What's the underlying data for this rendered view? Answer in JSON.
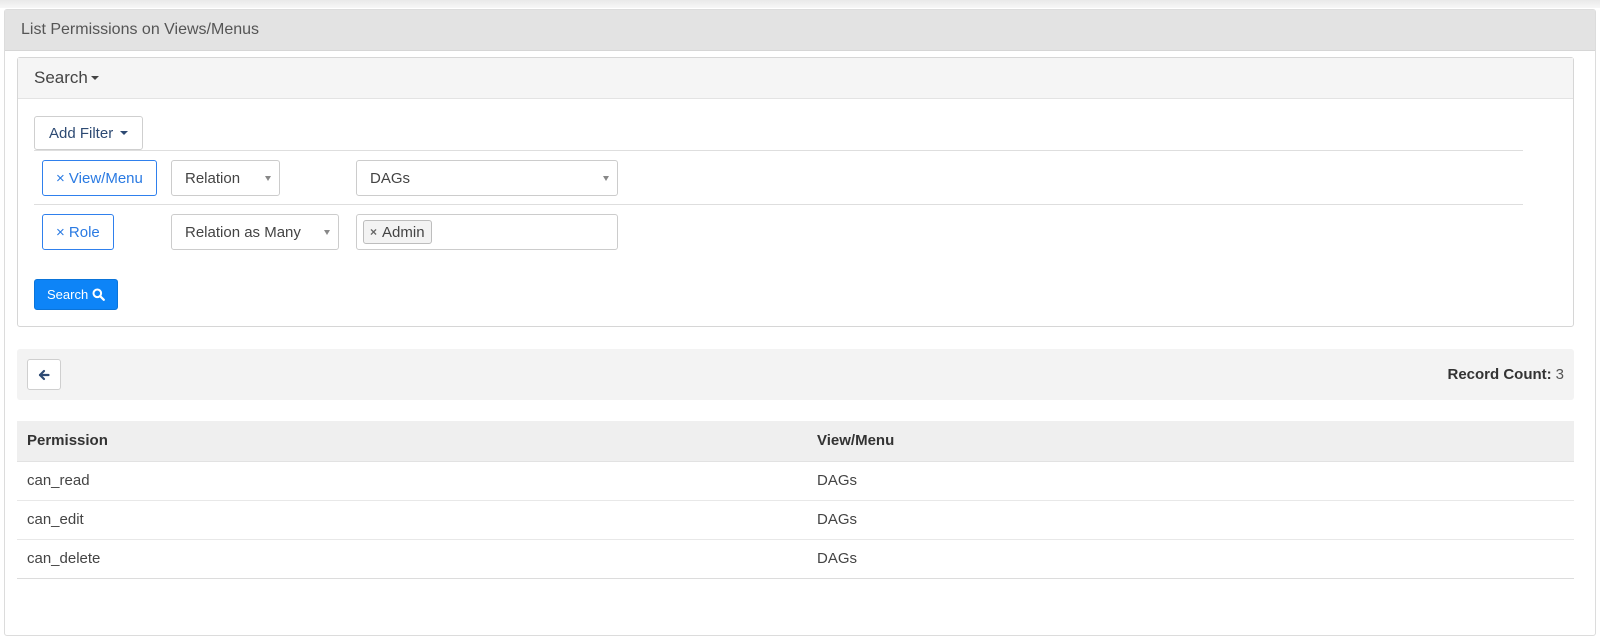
{
  "page_title": "List Permissions on Views/Menus",
  "search_panel": {
    "title": "Search",
    "add_filter_label": "Add Filter",
    "filters": [
      {
        "remove_label": "× View/Menu",
        "operator": "Relation",
        "value": "DAGs"
      },
      {
        "remove_label": "× Role",
        "operator": "Relation as Many",
        "tag": "Admin",
        "tag_remove": "×"
      }
    ],
    "search_button_label": "Search"
  },
  "list": {
    "record_count_label": "Record Count:",
    "record_count": "3",
    "columns": [
      "Permission",
      "View/Menu"
    ],
    "rows": [
      [
        "can_read",
        "DAGs"
      ],
      [
        "can_edit",
        "DAGs"
      ],
      [
        "can_delete",
        "DAGs"
      ]
    ]
  },
  "colors": {
    "primary": "#0d84f7",
    "link": "#2a7ae2",
    "header_bg": "#e3e3e3"
  },
  "icons": {
    "search": "search-icon",
    "back": "arrow-left-icon"
  }
}
